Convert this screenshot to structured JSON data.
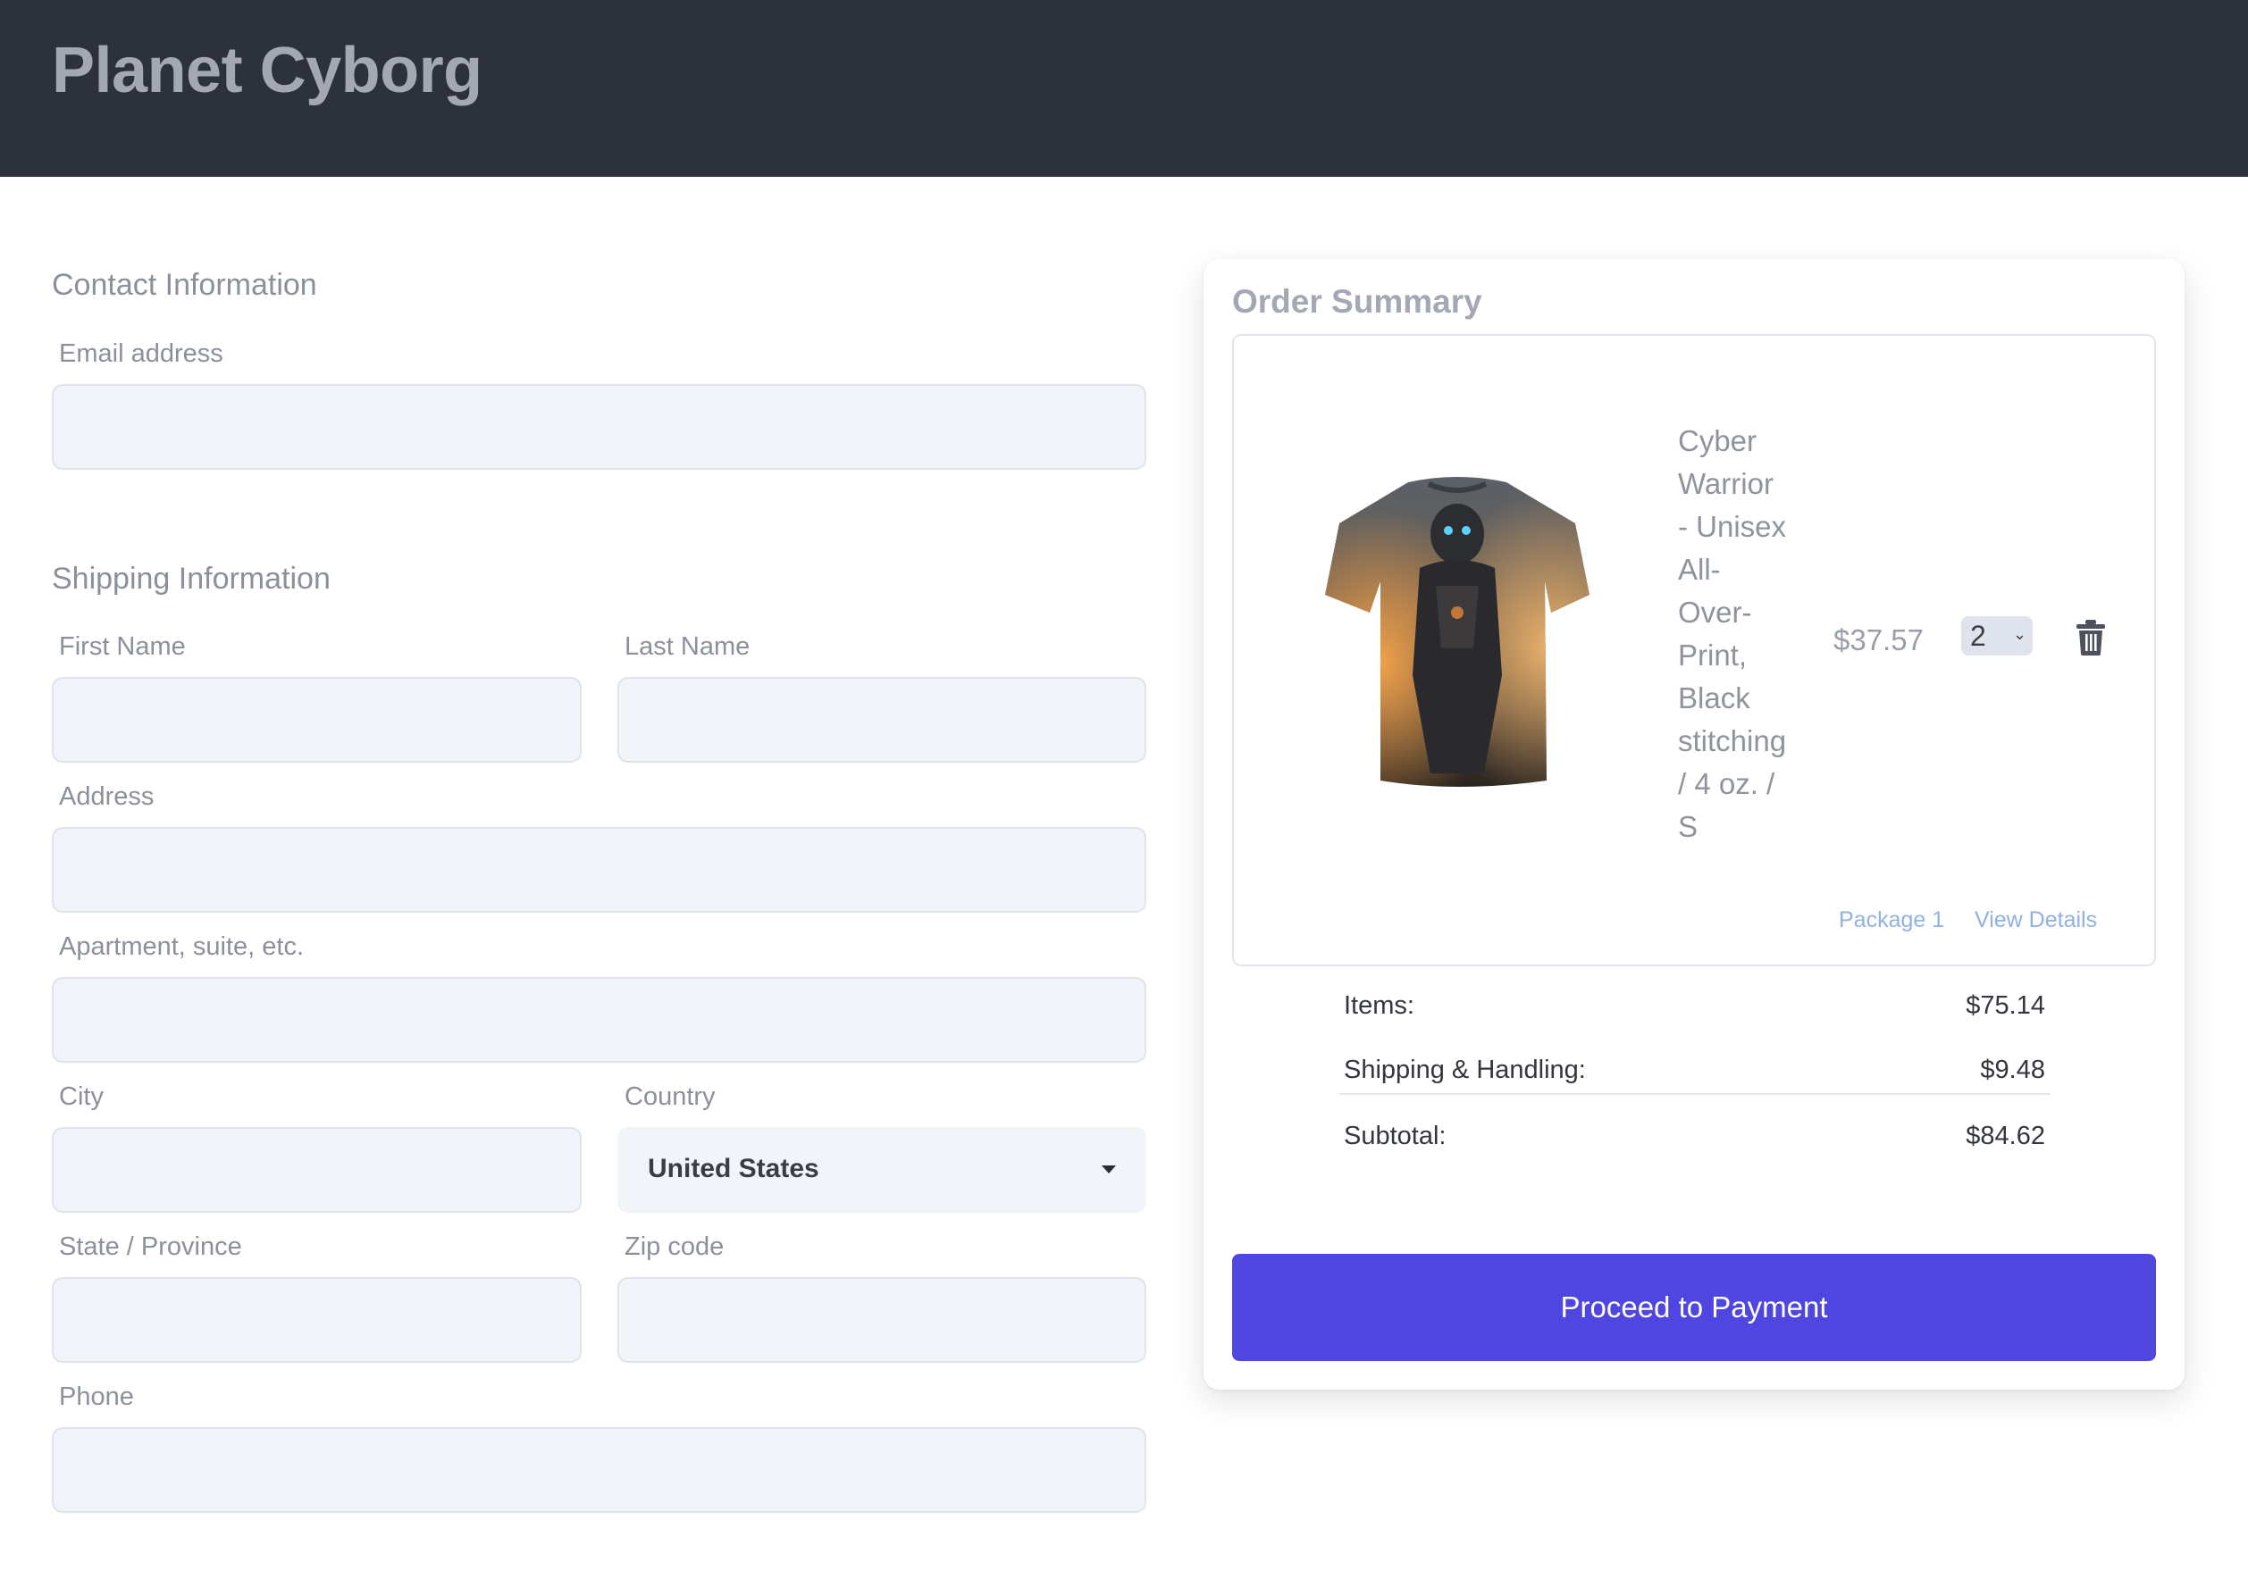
{
  "header": {
    "brand": "Planet Cyborg"
  },
  "contact": {
    "section_title": "Contact Information",
    "email_label": "Email address",
    "email_value": ""
  },
  "shipping": {
    "section_title": "Shipping Information",
    "first_name_label": "First Name",
    "last_name_label": "Last Name",
    "address_label": "Address",
    "apartment_label": "Apartment, suite, etc.",
    "city_label": "City",
    "country_label": "Country",
    "country_value": "United States",
    "state_label": "State / Province",
    "zip_label": "Zip code",
    "phone_label": "Phone"
  },
  "order_summary": {
    "title": "Order Summary",
    "item": {
      "name": "Cyber Warrior - Unisex All-Over-Print, Black stitching / 4 oz. / S",
      "name_lines": [
        "Cyber",
        "Warrior",
        "- Unisex",
        "All-",
        "Over-",
        "Print,",
        "Black",
        "stitching",
        "/ 4 oz. /",
        "S"
      ],
      "price": "$37.57",
      "quantity": "2",
      "image_icon": "tshirt-image",
      "delete_icon": "trash-icon"
    },
    "package_link": "Package 1",
    "details_link": "View Details",
    "totals": {
      "items_label": "Items:",
      "items_value": "$75.14",
      "shipping_label": "Shipping & Handling:",
      "shipping_value": "$9.48",
      "subtotal_label": "Subtotal:",
      "subtotal_value": "$84.62"
    },
    "pay_button": "Proceed to Payment"
  },
  "colors": {
    "header_bg": "#2d313c",
    "accent": "#4f46e0",
    "field_bg": "#f1f4f8",
    "link": "#8fb1e6"
  }
}
